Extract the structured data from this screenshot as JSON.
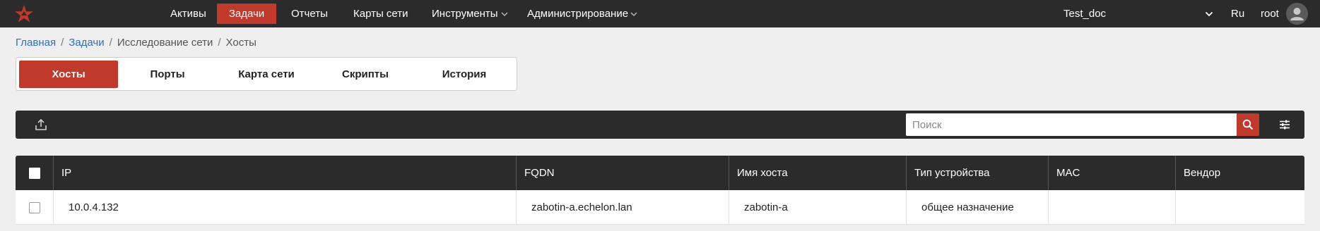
{
  "nav": {
    "items": [
      {
        "label": "Активы",
        "active": false
      },
      {
        "label": "Задачи",
        "active": true
      },
      {
        "label": "Отчеты",
        "active": false
      },
      {
        "label": "Карты сети",
        "active": false
      },
      {
        "label": "Инструменты",
        "active": false,
        "dropdown": true
      },
      {
        "label": "Администрирование",
        "active": false,
        "dropdown": true
      }
    ],
    "project": "Test_doc",
    "language": "Ru",
    "user": "root"
  },
  "breadcrumb": [
    "Главная",
    "Задачи",
    "Исследование сети",
    "Хосты"
  ],
  "tabs": [
    {
      "label": "Хосты",
      "active": true
    },
    {
      "label": "Порты",
      "active": false
    },
    {
      "label": "Карта сети",
      "active": false
    },
    {
      "label": "Скрипты",
      "active": false
    },
    {
      "label": "История",
      "active": false
    }
  ],
  "toolbar": {
    "search_placeholder": "Поиск",
    "search_value": ""
  },
  "table": {
    "columns": [
      "IP",
      "FQDN",
      "Имя хоста",
      "Тип устройства",
      "MAC",
      "Вендор"
    ],
    "rows": [
      {
        "ip": "10.0.4.132",
        "fqdn": "zabotin-a.echelon.lan",
        "hostname": "zabotin-a",
        "device_type": "общее назначение",
        "mac": "",
        "vendor": "",
        "checked": false
      }
    ],
    "header_checkbox_checked": false
  },
  "colors": {
    "accent": "#c0392b",
    "topbar": "#2b2b2b",
    "link": "#2d6fb8",
    "background": "#efefef"
  },
  "icons": {
    "logo": "red-star-logo",
    "export": "upload-icon",
    "search": "search-icon",
    "filter": "filter-sliders-icon",
    "avatar": "user-avatar-icon",
    "chevron": "chevron-down-icon"
  }
}
